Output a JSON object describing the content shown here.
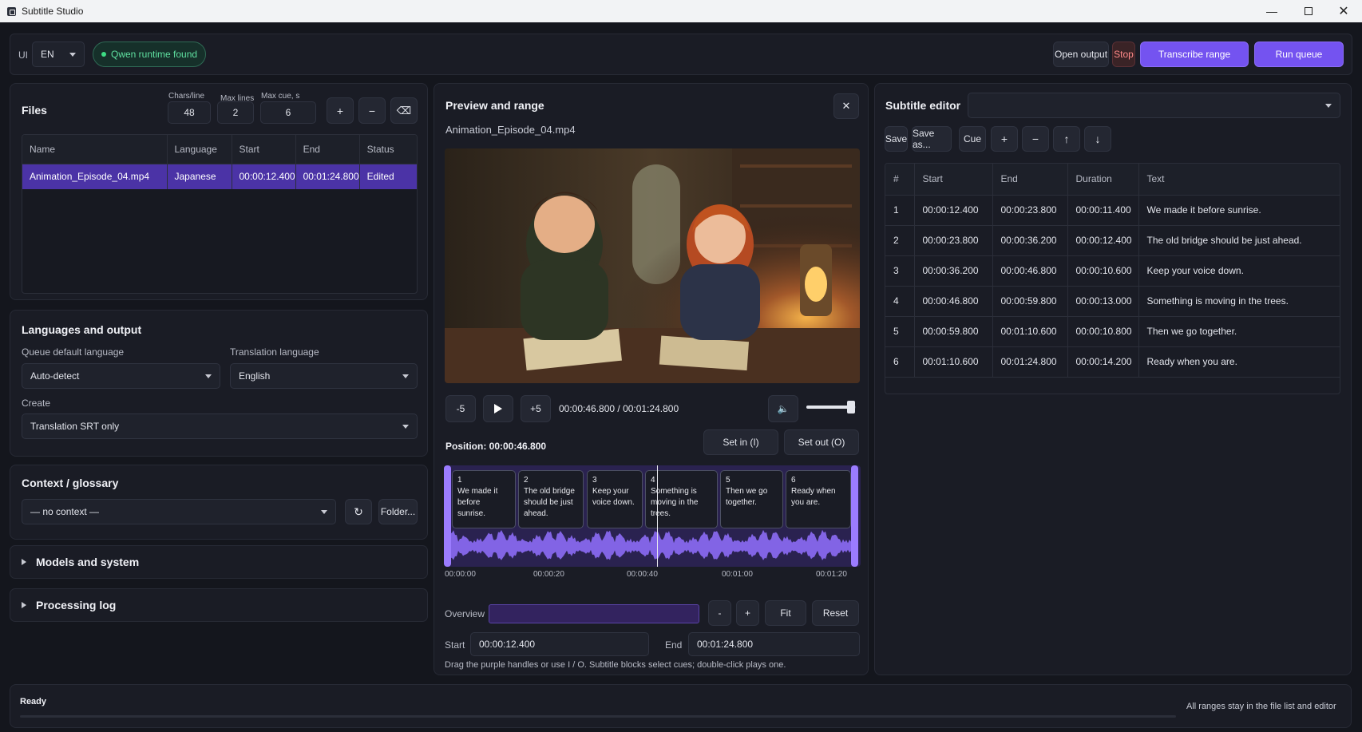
{
  "window": {
    "title": "Subtitle Studio"
  },
  "topbar": {
    "ui_label": "UI",
    "ui_lang": "EN",
    "runtime_status": "Qwen runtime found",
    "open_output": "Open output",
    "stop": "Stop",
    "transcribe_range": "Transcribe range",
    "run_queue": "Run queue"
  },
  "files": {
    "title": "Files",
    "chars_line_label": "Chars/line",
    "chars_line": "48",
    "max_lines_label": "Max lines",
    "max_lines": "2",
    "max_cue_label": "Max cue, s",
    "max_cue": "6",
    "add": "+",
    "remove": "−",
    "columns": [
      "Name",
      "Language",
      "Start",
      "End",
      "Status"
    ],
    "rows": [
      {
        "name": "Animation_Episode_04.mp4",
        "language": "Japanese",
        "start": "00:00:12.400",
        "end": "00:01:24.800",
        "status": "Edited"
      }
    ]
  },
  "languages": {
    "title": "Languages and output",
    "queue_label": "Queue default language",
    "queue_value": "Auto-detect",
    "translation_label": "Translation language",
    "translation_value": "English",
    "create_label": "Create",
    "create_value": "Translation SRT only"
  },
  "context": {
    "title": "Context / glossary",
    "value": "— no context —",
    "folder": "Folder..."
  },
  "models": {
    "title": "Models and system"
  },
  "log": {
    "title": "Processing log"
  },
  "preview": {
    "title": "Preview and range",
    "filename": "Animation_Episode_04.mp4",
    "back5": "-5",
    "fwd5": "+5",
    "time_display": "00:00:46.800 / 00:01:24.800",
    "volume": 0.9,
    "position": "Position: 00:00:46.800",
    "set_in": "Set in (I)",
    "set_out": "Set out (O)",
    "timeline_ticks": [
      "00:00:00",
      "00:00:20",
      "00:00:40",
      "00:01:00",
      "00:01:20"
    ],
    "cues": [
      {
        "n": "1",
        "text": "We made it before sunrise."
      },
      {
        "n": "2",
        "text": "The old bridge should be just ahead."
      },
      {
        "n": "3",
        "text": "Keep your voice down."
      },
      {
        "n": "4",
        "text": "Something is moving in the trees."
      },
      {
        "n": "5",
        "text": "Then we go together."
      },
      {
        "n": "6",
        "text": "Ready when you are."
      }
    ],
    "overview_label": "Overview",
    "zoom_out": "-",
    "zoom_in": "+",
    "fit": "Fit",
    "reset": "Reset",
    "start_label": "Start",
    "start_value": "00:00:12.400",
    "end_label": "End",
    "end_value": "00:01:24.800",
    "hint": "Drag the purple handles or use I / O. Subtitle blocks select cues; double-click plays one."
  },
  "editor": {
    "title": "Subtitle editor",
    "save": "Save",
    "save_as": "Save as...",
    "cue": "Cue",
    "add": "+",
    "remove": "−",
    "up": "↑",
    "down": "↓",
    "columns": [
      "#",
      "Start",
      "End",
      "Duration",
      "Text"
    ],
    "rows": [
      {
        "n": "1",
        "start": "00:00:12.400",
        "end": "00:00:23.800",
        "dur": "00:00:11.400",
        "text": "We made it before sunrise."
      },
      {
        "n": "2",
        "start": "00:00:23.800",
        "end": "00:00:36.200",
        "dur": "00:00:12.400",
        "text": "The old bridge should be just ahead."
      },
      {
        "n": "3",
        "start": "00:00:36.200",
        "end": "00:00:46.800",
        "dur": "00:00:10.600",
        "text": "Keep your voice down."
      },
      {
        "n": "4",
        "start": "00:00:46.800",
        "end": "00:00:59.800",
        "dur": "00:00:13.000",
        "text": "Something is moving in the trees."
      },
      {
        "n": "5",
        "start": "00:00:59.800",
        "end": "00:01:10.600",
        "dur": "00:00:10.800",
        "text": "Then we go together."
      },
      {
        "n": "6",
        "start": "00:01:10.600",
        "end": "00:01:24.800",
        "dur": "00:00:14.200",
        "text": "Ready when you are."
      }
    ]
  },
  "status": {
    "left": "Ready",
    "right": "All ranges stay in the file list and editor"
  },
  "colors": {
    "accent": "#7453f0",
    "background": "#14161d",
    "panel": "#1a1c25",
    "status_green": "#3ddc84"
  }
}
